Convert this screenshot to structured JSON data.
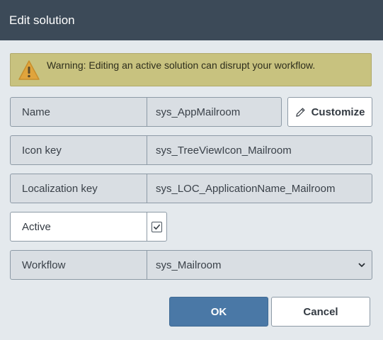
{
  "dialog": {
    "title": "Edit solution"
  },
  "warning": {
    "text": "Warning: Editing an active solution can disrupt your workflow.",
    "icon": "warning-triangle-icon",
    "color": "#c8c27f"
  },
  "fields": {
    "name": {
      "label": "Name",
      "value": "sys_AppMailroom"
    },
    "icon_key": {
      "label": "Icon key",
      "value": "sys_TreeViewIcon_Mailroom"
    },
    "localization_key": {
      "label": "Localization key",
      "value": "sys_LOC_ApplicationName_Mailroom"
    },
    "active": {
      "label": "Active",
      "checked": true
    },
    "workflow": {
      "label": "Workflow",
      "value": "sys_Mailroom"
    }
  },
  "buttons": {
    "customize": {
      "label": "Customize",
      "icon": "pencil-icon"
    },
    "ok": {
      "label": "OK",
      "color": "#4a78a6"
    },
    "cancel": {
      "label": "Cancel"
    }
  },
  "colors": {
    "titlebar": "#3c4a58",
    "background": "#e4e9ed"
  }
}
